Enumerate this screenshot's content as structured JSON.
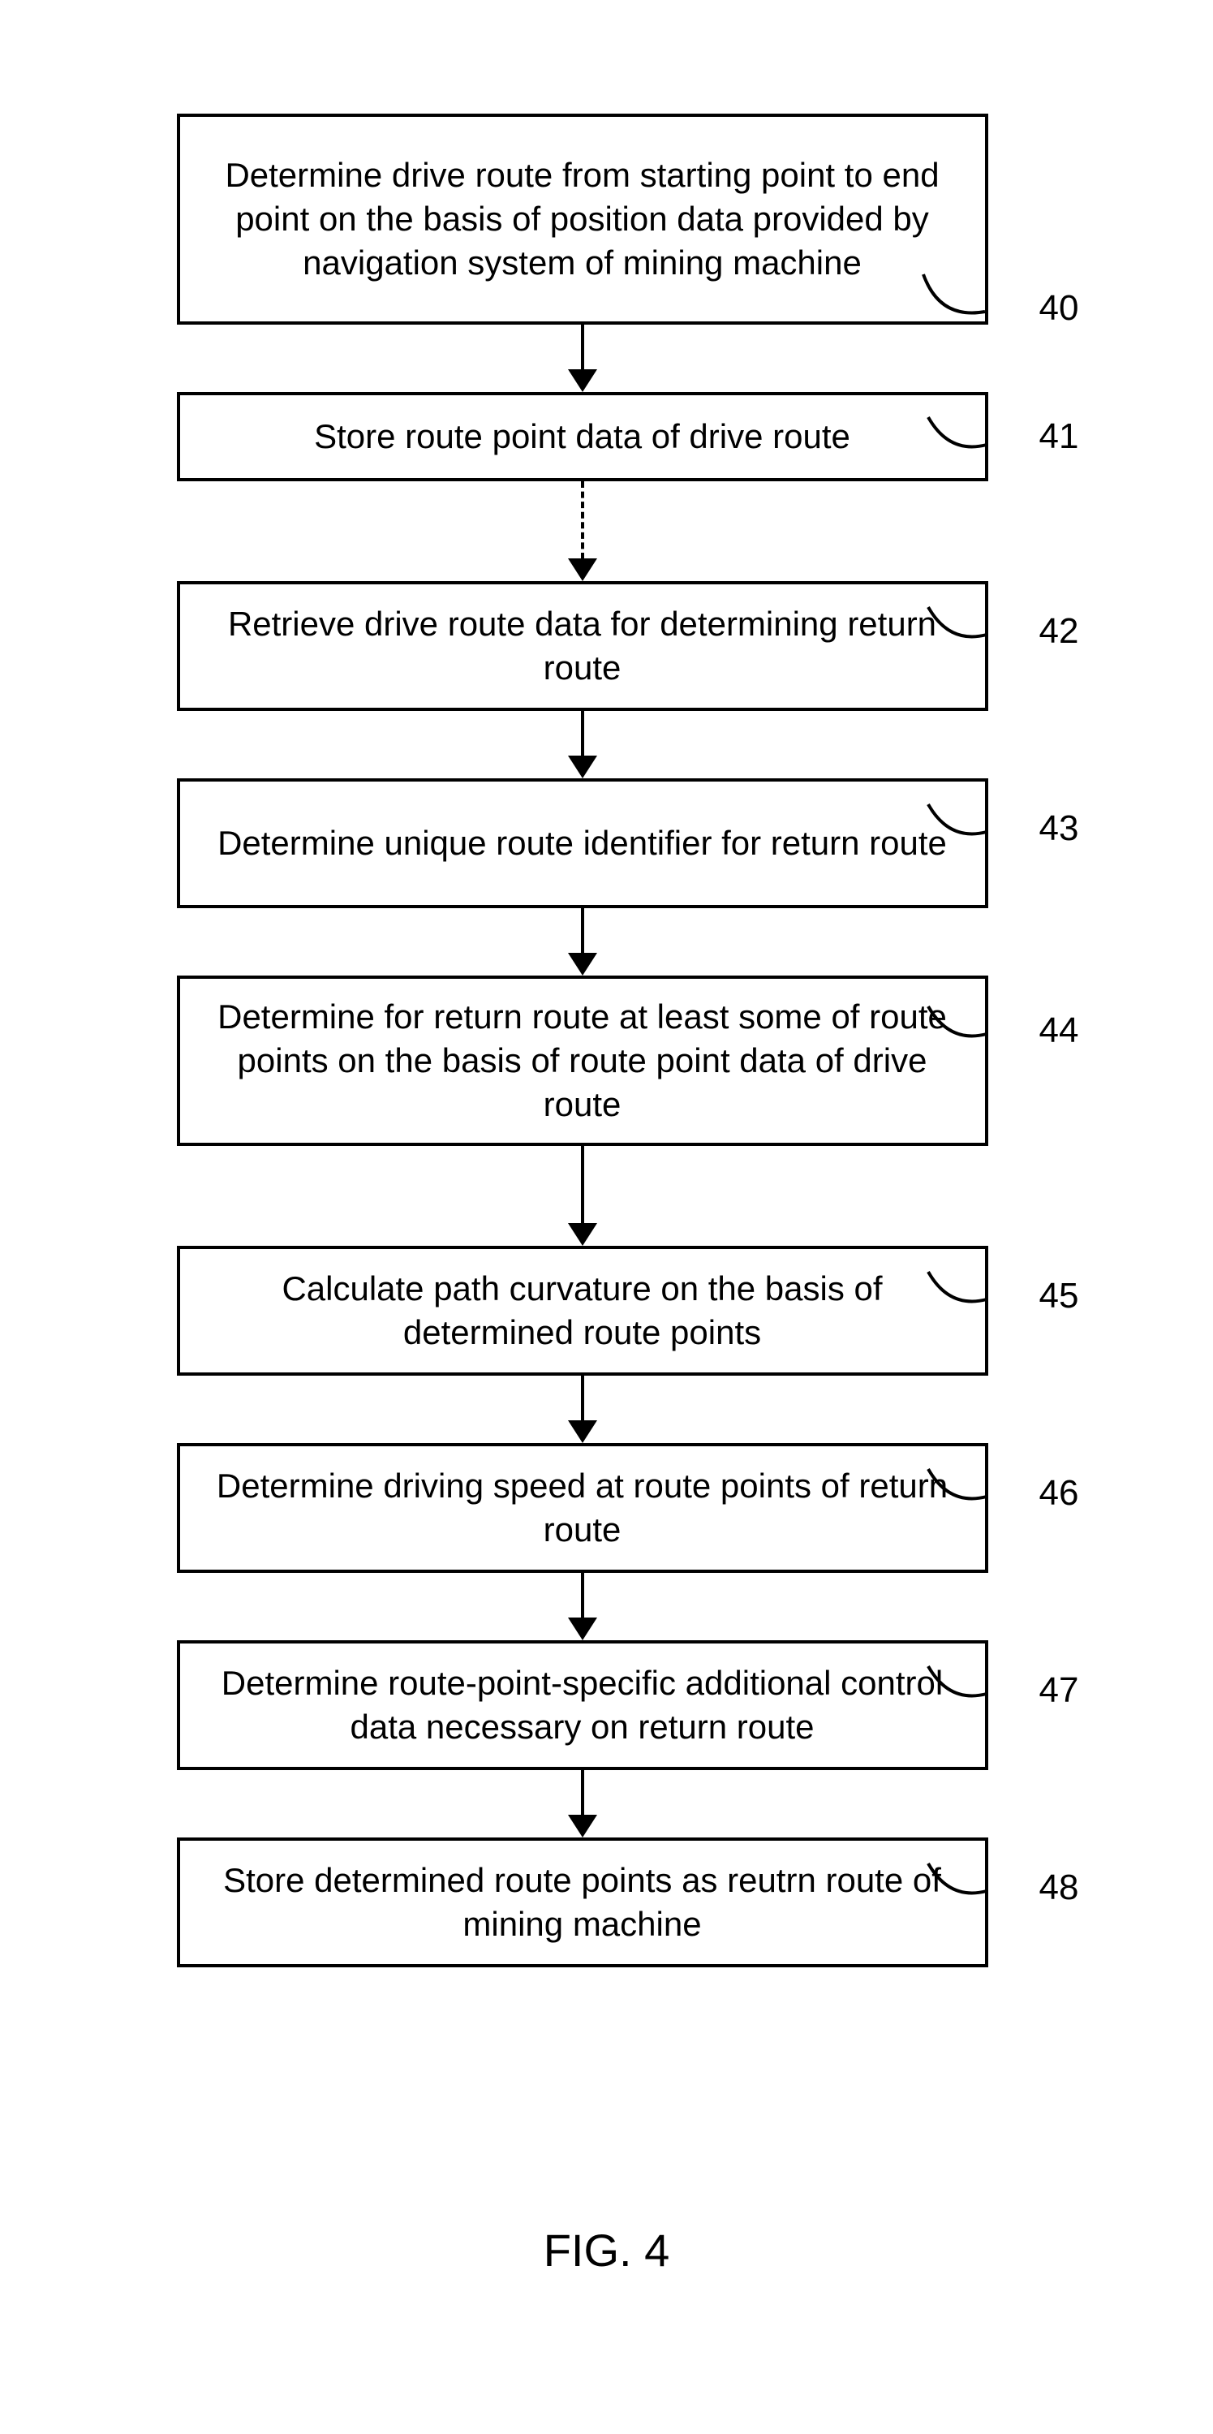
{
  "figure_caption": "FIG. 4",
  "steps": [
    {
      "id": "40",
      "text": "Determine drive route from starting point to end point on the basis of position data provided by navigation system of mining machine"
    },
    {
      "id": "41",
      "text": "Store route point data of drive route"
    },
    {
      "id": "42",
      "text": "Retrieve drive route data for determining return route"
    },
    {
      "id": "43",
      "text": "Determine unique route identifier for return route"
    },
    {
      "id": "44",
      "text": "Determine for return route at least some of route points on the basis of route point data of drive route"
    },
    {
      "id": "45",
      "text": "Calculate path curvature on the basis of determined route points"
    },
    {
      "id": "46",
      "text": "Determine driving speed at route points of return route"
    },
    {
      "id": "47",
      "text": "Determine route-point-specific additional control data necessary on return route"
    },
    {
      "id": "48",
      "text": "Store determined route points as reutrn route of mining machine"
    }
  ],
  "arrows": [
    {
      "from": "40",
      "to": "41",
      "style": "solid"
    },
    {
      "from": "41",
      "to": "42",
      "style": "dashed"
    },
    {
      "from": "42",
      "to": "43",
      "style": "solid"
    },
    {
      "from": "43",
      "to": "44",
      "style": "solid"
    },
    {
      "from": "44",
      "to": "45",
      "style": "solid"
    },
    {
      "from": "45",
      "to": "46",
      "style": "solid"
    },
    {
      "from": "46",
      "to": "47",
      "style": "solid"
    },
    {
      "from": "47",
      "to": "48",
      "style": "solid"
    }
  ]
}
